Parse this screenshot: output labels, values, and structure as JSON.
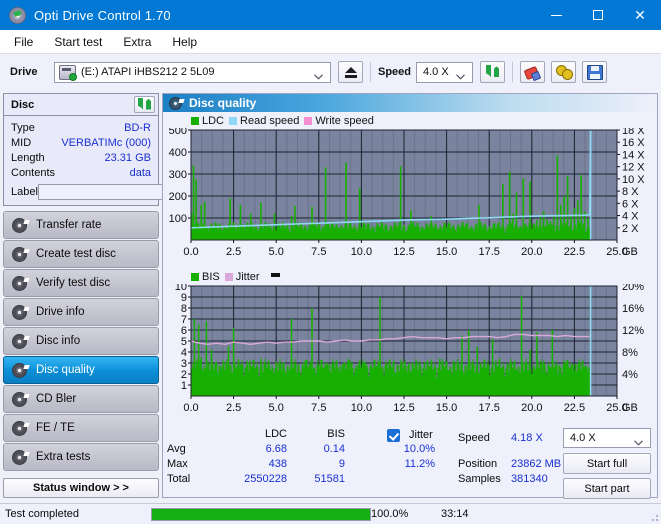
{
  "window": {
    "title": "Opti Drive Control 1.70",
    "icon": "disc-icon",
    "minimize": "–",
    "maximize": "□",
    "close": "✕"
  },
  "menu": {
    "items": [
      {
        "label": "File"
      },
      {
        "label": "Start test"
      },
      {
        "label": "Extra"
      },
      {
        "label": "Help"
      }
    ]
  },
  "toolbar": {
    "drive_label": "Drive",
    "drive_value": "(E:)   ATAPI iHBS212   2 5L09",
    "eject_icon": "eject-icon",
    "speed_label": "Speed",
    "speed_value": "4.0 X",
    "refresh_icon": "refresh-icon",
    "eraser_icon": "eraser-icon",
    "gears_icon": "gears-icon",
    "save_icon": "save-icon"
  },
  "disc_panel": {
    "title": "Disc",
    "refresh_icon": "refresh-icon",
    "rows": [
      {
        "key": "Type",
        "value": "BD-R"
      },
      {
        "key": "MID",
        "value": "VERBATIMc (000)"
      },
      {
        "key": "Length",
        "value": "23.31 GB"
      },
      {
        "key": "Contents",
        "value": "data"
      }
    ],
    "label_key": "Label",
    "label_value": "",
    "label_placeholder": "",
    "disc_icon": "cd-icon"
  },
  "sidebar": {
    "items": [
      {
        "label": "Transfer rate",
        "icon": "disc-test-icon",
        "active": false
      },
      {
        "label": "Create test disc",
        "icon": "disc-test-icon",
        "active": false
      },
      {
        "label": "Verify test disc",
        "icon": "disc-test-icon",
        "active": false
      },
      {
        "label": "Drive info",
        "icon": "disc-test-icon",
        "active": false
      },
      {
        "label": "Disc info",
        "icon": "disc-test-icon",
        "active": false
      },
      {
        "label": "Disc quality",
        "icon": "disc-test-icon",
        "active": true
      },
      {
        "label": "CD Bler",
        "icon": "disc-test-icon",
        "active": false
      },
      {
        "label": "FE / TE",
        "icon": "disc-test-icon",
        "active": false
      },
      {
        "label": "Extra tests",
        "icon": "disc-test-icon",
        "active": false
      }
    ],
    "status_window_button": "Status window > >"
  },
  "content": {
    "header": "Disc quality",
    "header_icon": "disc-test-icon"
  },
  "chart_data": [
    {
      "type": "bar",
      "id": "ldc-chart",
      "title": "",
      "legend": [
        {
          "name": "LDC",
          "color": "#18b000"
        },
        {
          "name": "Read speed",
          "color": "#8fd8f4"
        },
        {
          "name": "Write speed",
          "color": "#f58fd0"
        }
      ],
      "legend_position": "top-left",
      "grid": true,
      "xlabel": "GB",
      "x_ticks": [
        "0.0",
        "2.5",
        "5.0",
        "7.5",
        "10.0",
        "12.5",
        "15.0",
        "17.5",
        "20.0",
        "22.5",
        "25.0"
      ],
      "xlim": [
        0,
        25
      ],
      "ylabel_left": "LDC",
      "y_ticks_left": [
        "100",
        "200",
        "300",
        "400",
        "500"
      ],
      "ylim_left": [
        0,
        500
      ],
      "ylabel_right": "Speed",
      "y_ticks_right": [
        "2 X",
        "4 X",
        "6 X",
        "8 X",
        "10 X",
        "12 X",
        "14 X",
        "16 X",
        "18 X"
      ],
      "ylim_right": [
        0,
        18
      ],
      "series": [
        {
          "name": "LDC",
          "color": "#18b000",
          "x": [
            0.05,
            0.15,
            0.25,
            0.3,
            0.4,
            0.5,
            0.6,
            0.7,
            0.8,
            0.9,
            1.0,
            1.1,
            1.2,
            1.3,
            1.5,
            1.7,
            1.9,
            2.1,
            2.3,
            2.5,
            2.7,
            2.9,
            3.1,
            3.3,
            3.5,
            3.7,
            3.9,
            4.1,
            4.3,
            4.5,
            4.7,
            4.9,
            5.1,
            5.3,
            5.5,
            5.7,
            5.9,
            6.1,
            6.3,
            6.5,
            6.7,
            6.9,
            7.1,
            7.3,
            7.5,
            7.7,
            7.9,
            8.1,
            8.3,
            8.5,
            8.7,
            8.9,
            9.1,
            9.3,
            9.5,
            9.7,
            9.9,
            10.1,
            10.3,
            10.5,
            10.7,
            10.9,
            11.1,
            11.3,
            11.5,
            11.7,
            11.9,
            12.1,
            12.3,
            12.5,
            12.7,
            12.9,
            13.1,
            13.3,
            13.5,
            13.7,
            13.9,
            14.1,
            14.3,
            14.5,
            14.7,
            14.9,
            15.1,
            15.3,
            15.5,
            15.7,
            15.9,
            16.1,
            16.3,
            16.5,
            16.7,
            16.9,
            17.1,
            17.3,
            17.5,
            17.7,
            17.9,
            18.1,
            18.3,
            18.5,
            18.7,
            18.9,
            19.1,
            19.3,
            19.5,
            19.7,
            19.9,
            20.1,
            20.3,
            20.5,
            20.7,
            20.9,
            21.1,
            21.3,
            21.5,
            21.7,
            21.9,
            22.1,
            22.3,
            22.5,
            22.7,
            22.9,
            23.1,
            23.3
          ],
          "values": [
            120,
            340,
            70,
            275,
            60,
            55,
            160,
            50,
            175,
            48,
            45,
            60,
            42,
            40,
            55,
            48,
            42,
            50,
            190,
            40,
            45,
            160,
            55,
            42,
            120,
            50,
            45,
            170,
            60,
            42,
            55,
            120,
            48,
            42,
            50,
            45,
            110,
            155,
            40,
            42,
            48,
            55,
            150,
            45,
            42,
            50,
            330,
            45,
            40,
            48,
            55,
            42,
            350,
            50,
            45,
            42,
            235,
            48,
            40,
            45,
            52,
            42,
            48,
            40,
            45,
            50,
            42,
            48,
            335,
            45,
            42,
            135,
            50,
            45,
            40,
            48,
            42,
            110,
            50,
            45,
            42,
            48,
            40,
            52,
            45,
            42,
            48,
            40,
            45,
            50,
            42,
            160,
            48,
            40,
            45,
            42,
            48,
            40,
            255,
            45,
            310,
            120,
            215,
            60,
            280,
            55,
            265,
            70,
            90,
            105,
            130,
            95,
            85,
            110,
            385,
            160,
            200,
            290,
            115,
            145,
            180,
            295,
            130,
            100
          ]
        },
        {
          "name": "Read speed",
          "color": "#8fd8f4",
          "x": [
            0.0,
            1.0,
            2.0,
            3.0,
            4.0,
            5.0,
            6.0,
            7.0,
            8.0,
            9.0,
            10.0,
            11.0,
            12.0,
            13.0,
            14.0,
            15.0,
            16.0,
            17.0,
            18.0,
            19.0,
            20.0,
            21.0,
            22.0,
            23.0,
            23.4,
            23.45
          ],
          "values": [
            2.0,
            2.1,
            2.2,
            2.3,
            2.4,
            2.5,
            2.6,
            2.7,
            2.8,
            2.9,
            3.0,
            3.1,
            3.2,
            3.3,
            3.35,
            3.4,
            3.5,
            3.6,
            3.7,
            3.8,
            3.9,
            3.95,
            4.0,
            4.05,
            4.1,
            18.0
          ]
        }
      ]
    },
    {
      "type": "bar",
      "id": "bis-chart",
      "title": "",
      "legend": [
        {
          "name": "BIS",
          "color": "#18b000"
        },
        {
          "name": "Jitter",
          "color": "#d9a8d9"
        }
      ],
      "legend_position": "top-left",
      "grid": true,
      "xlabel": "GB",
      "x_ticks": [
        "0.0",
        "2.5",
        "5.0",
        "7.5",
        "10.0",
        "12.5",
        "15.0",
        "17.5",
        "20.0",
        "22.5",
        "25.0"
      ],
      "xlim": [
        0,
        25
      ],
      "ylabel_left": "BIS",
      "y_ticks_left": [
        "1",
        "2",
        "3",
        "4",
        "5",
        "6",
        "7",
        "8",
        "9",
        "10"
      ],
      "ylim_left": [
        0,
        10
      ],
      "ylabel_right": "Jitter",
      "y_ticks_right": [
        "4%",
        "8%",
        "12%",
        "16%",
        "20%"
      ],
      "ylim_right": [
        0,
        20
      ],
      "series": [
        {
          "name": "BIS",
          "color": "#18b000",
          "baseline": 1.6,
          "spikes_x": [
            0.2,
            0.45,
            0.6,
            0.9,
            1.2,
            1.5,
            1.8,
            2.2,
            2.5,
            2.9,
            3.3,
            3.7,
            4.1,
            4.6,
            5.0,
            5.4,
            5.9,
            6.3,
            6.7,
            7.1,
            7.6,
            8.0,
            8.4,
            8.9,
            9.3,
            9.8,
            10.2,
            10.6,
            11.1,
            11.5,
            11.9,
            12.4,
            12.8,
            13.2,
            13.7,
            14.1,
            14.6,
            15.0,
            15.4,
            15.9,
            16.3,
            16.8,
            17.2,
            17.7,
            18.1,
            18.6,
            19.0,
            19.4,
            19.9,
            20.3,
            20.7,
            21.2,
            21.6,
            22.0,
            22.4,
            22.8,
            23.1,
            23.35
          ],
          "spikes_y": [
            7,
            6.5,
            3.5,
            6.8,
            4.2,
            3.1,
            2.6,
            4.5,
            6.2,
            2.8,
            3.2,
            2.5,
            3.4,
            2.8,
            3.0,
            2.6,
            7.0,
            2.8,
            3.2,
            8.0,
            2.7,
            3.0,
            2.6,
            2.9,
            3.3,
            2.8,
            3.1,
            2.7,
            9.0,
            2.9,
            3.2,
            2.6,
            3.0,
            2.8,
            3.1,
            2.7,
            3.4,
            2.9,
            3.2,
            5.5,
            6.0,
            4.5,
            3.0,
            5.2,
            3.4,
            2.9,
            3.1,
            9.1,
            4.2,
            5.8,
            3.2,
            6.0,
            2.8,
            3.1,
            2.9,
            3.0,
            2.7,
            2.6
          ]
        },
        {
          "name": "Jitter",
          "color": "#d9a8d9",
          "x": [
            0.0,
            0.5,
            1.0,
            1.5,
            2.0,
            2.5,
            3.0,
            3.5,
            4.0,
            4.5,
            5.0,
            5.5,
            6.0,
            6.5,
            7.0,
            7.5,
            8.0,
            8.5,
            9.0,
            9.5,
            10.0,
            10.5,
            11.0,
            11.5,
            12.0,
            12.5,
            13.0,
            13.5,
            14.0,
            14.5,
            15.0,
            15.5,
            16.0,
            16.5,
            17.0,
            17.5,
            18.0,
            18.5,
            19.0,
            19.5,
            20.0,
            20.5,
            21.0,
            21.5,
            22.0,
            22.5,
            23.0,
            23.4
          ],
          "values": [
            5.0,
            4.8,
            4.7,
            4.8,
            4.7,
            4.9,
            4.8,
            4.7,
            4.8,
            4.9,
            4.8,
            4.9,
            4.9,
            5.0,
            5.0,
            5.0,
            4.9,
            5.0,
            5.1,
            5.0,
            5.0,
            5.1,
            5.1,
            5.2,
            5.2,
            5.3,
            5.4,
            5.3,
            5.3,
            5.3,
            5.2,
            5.3,
            5.3,
            5.4,
            5.4,
            5.4,
            5.3,
            5.4,
            5.6,
            5.6,
            5.5,
            5.5,
            5.5,
            5.4,
            5.5,
            5.4,
            5.4,
            5.4
          ]
        }
      ]
    }
  ],
  "stats": {
    "col_headers": [
      "LDC",
      "BIS"
    ],
    "rows": [
      {
        "label": "Avg",
        "ldc": "6.68",
        "bis": "0.14",
        "jitter": "10.0%"
      },
      {
        "label": "Max",
        "ldc": "438",
        "bis": "9",
        "jitter": "11.2%"
      },
      {
        "label": "Total",
        "ldc": "2550228",
        "bis": "51581",
        "jitter": ""
      }
    ],
    "jitter_label": "Jitter",
    "jitter_checked": true,
    "speed_label": "Speed",
    "speed_value": "4.18 X",
    "position_label": "Position",
    "position_value": "23862 MB",
    "samples_label": "Samples",
    "samples_value": "381340",
    "speed_select": "4.0 X",
    "start_full": "Start full",
    "start_part": "Start part"
  },
  "statusbar": {
    "message": "Test completed",
    "progress_percent": "100.0%",
    "progress_value": 100,
    "elapsed": "33:14"
  },
  "colors": {
    "accent": "#0078d4",
    "link": "#1a2fd0",
    "ldc": "#18b000",
    "read_speed": "#8fd8f4",
    "write_speed": "#f58fd0",
    "jitter": "#d9a8d9",
    "plot_bg": "#7a849e",
    "progress": "#14b014"
  }
}
